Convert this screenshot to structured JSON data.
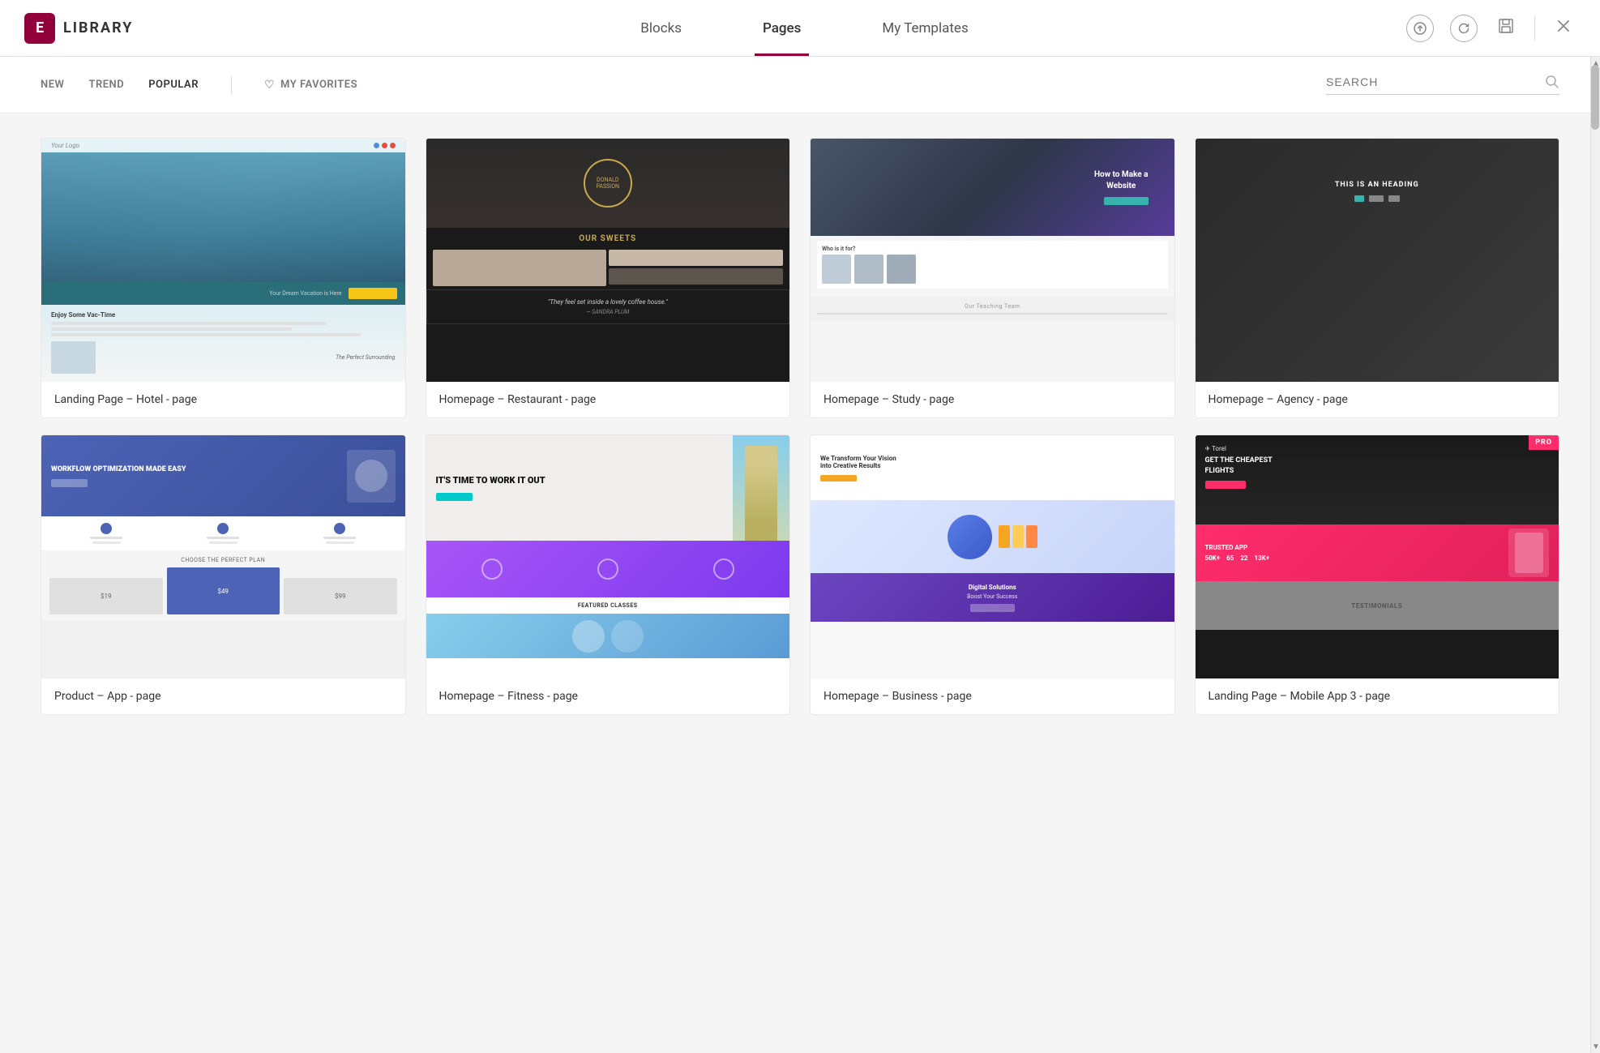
{
  "header": {
    "logo_letter": "E",
    "logo_title": "LIBRARY",
    "nav": {
      "tabs": [
        {
          "id": "blocks",
          "label": "Blocks",
          "active": false
        },
        {
          "id": "pages",
          "label": "Pages",
          "active": true
        },
        {
          "id": "my-templates",
          "label": "My Templates",
          "active": false
        }
      ]
    },
    "actions": {
      "upload_tooltip": "Upload",
      "refresh_tooltip": "Refresh",
      "save_tooltip": "Save",
      "close_tooltip": "Close"
    }
  },
  "filter": {
    "tabs": [
      {
        "id": "new",
        "label": "NEW",
        "active": false
      },
      {
        "id": "trend",
        "label": "TREND",
        "active": false
      },
      {
        "id": "popular",
        "label": "POPULAR",
        "active": false
      }
    ],
    "favorites_label": "MY FAVORITES",
    "search_placeholder": "SEARCH"
  },
  "templates": {
    "row1": [
      {
        "id": "hotel",
        "label": "Landing Page – Hotel - page",
        "type": "hotel",
        "pro": false
      },
      {
        "id": "restaurant",
        "label": "Homepage – Restaurant - page",
        "type": "restaurant",
        "pro": false
      },
      {
        "id": "study",
        "label": "Homepage – Study - page",
        "type": "study",
        "pro": false
      },
      {
        "id": "agency",
        "label": "Homepage – Agency - page",
        "type": "agency",
        "pro": false
      }
    ],
    "row2": [
      {
        "id": "product",
        "label": "Product – App - page",
        "type": "product",
        "pro": false,
        "hero_text": "WORKFLOW OPTIMIZATION MADE EASY"
      },
      {
        "id": "fitness",
        "label": "Homepage – Fitness - page",
        "type": "fitness",
        "pro": false,
        "hero_text": "IT'S TIME TO WORK IT OUT"
      },
      {
        "id": "business",
        "label": "Homepage – Business - page",
        "type": "business",
        "pro": false
      },
      {
        "id": "mobile",
        "label": "Landing Page – Mobile App 3 - page",
        "type": "mobile",
        "pro": true,
        "pro_label": "PRO"
      }
    ]
  }
}
